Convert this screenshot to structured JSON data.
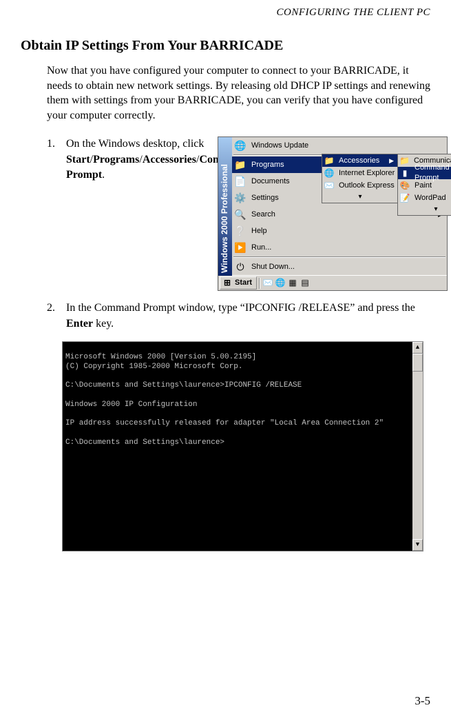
{
  "running_header": "CONFIGURING THE CLIENT PC",
  "section_title": "Obtain IP Settings From Your BARRICADE",
  "intro": "Now that you have configured your computer to connect to your BARRICADE, it needs to obtain new network settings. By releasing old DHCP IP settings and renewing them with settings from your BARRICADE, you can verify that you have configured your computer correctly.",
  "step1": {
    "num": "1.",
    "pre": "On the Windows desktop, click ",
    "b1": "Start",
    "s1": "/",
    "b2": "Programs",
    "s2": "/",
    "b3": "Accessories",
    "s3": "/",
    "b4": "Command Prompt",
    "post": "."
  },
  "step2": {
    "num": "2.",
    "pre": "In the Command Prompt window, type “IPCONFIG /RELEASE” and press the ",
    "b1": "Enter",
    "post": " key."
  },
  "startmenu": {
    "banner_line1": "Windows 2000",
    "banner_line2": "Professional",
    "items": [
      {
        "icon": "🌐",
        "label": "Windows Update"
      },
      {
        "icon": "📁",
        "label": "Programs",
        "arrow": true,
        "sel": true
      },
      {
        "icon": "📄",
        "label": "Documents",
        "arrow": true
      },
      {
        "icon": "⚙️",
        "label": "Settings",
        "arrow": true
      },
      {
        "icon": "🔍",
        "label": "Search",
        "arrow": true
      },
      {
        "icon": "❔",
        "label": "Help"
      },
      {
        "icon": "▶️",
        "label": "Run..."
      },
      {
        "icon": "⏻",
        "label": "Shut Down..."
      }
    ],
    "sub1": [
      {
        "icon": "📁",
        "label": "Accessories",
        "arrow": true,
        "sel": true
      },
      {
        "icon": "🌐",
        "label": "Internet Explorer"
      },
      {
        "icon": "✉️",
        "label": "Outlook Express"
      }
    ],
    "sub2": [
      {
        "icon": "📁",
        "label": "Communications",
        "arrow": true
      },
      {
        "icon": "▮",
        "label": "Command Prompt",
        "sel": true
      },
      {
        "icon": "🎨",
        "label": "Paint"
      },
      {
        "icon": "📝",
        "label": "WordPad"
      }
    ],
    "taskbar": {
      "start": "Start",
      "icons": [
        "✉️",
        "🌐",
        "▦",
        "▤"
      ]
    }
  },
  "cmd": {
    "l1": "Microsoft Windows 2000 [Version 5.00.2195]",
    "l2": "(C) Copyright 1985-2000 Microsoft Corp.",
    "l3": "C:\\Documents and Settings\\laurence>IPCONFIG /RELEASE",
    "l4": "Windows 2000 IP Configuration",
    "l5": "IP address successfully released for adapter \"Local Area Connection 2\"",
    "l6": "C:\\Documents and Settings\\laurence>"
  },
  "page_number": "3-5"
}
